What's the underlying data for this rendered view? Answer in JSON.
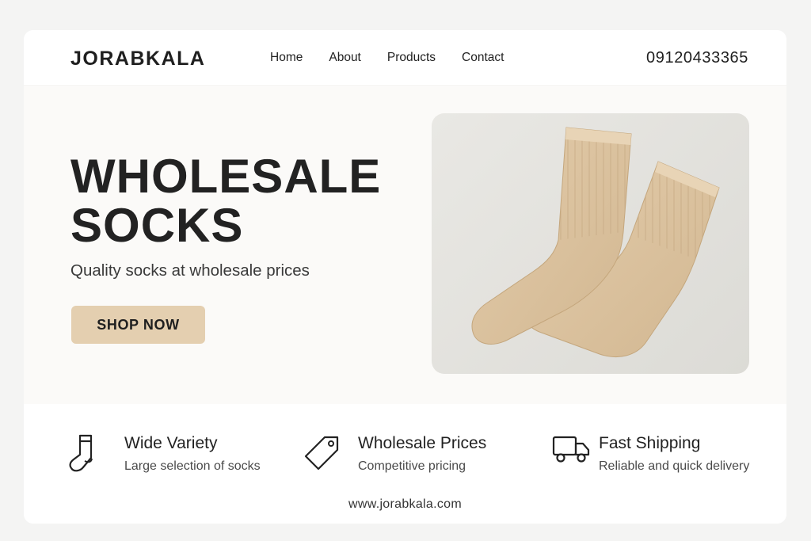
{
  "brand": {
    "logo_text": "JORABKALA"
  },
  "nav": {
    "items": [
      {
        "label": "Home"
      },
      {
        "label": "About"
      },
      {
        "label": "Products"
      },
      {
        "label": "Contact"
      }
    ]
  },
  "header": {
    "phone": "09120433365"
  },
  "hero": {
    "title_line1": "WHOLESALE",
    "title_line2": "SOCKS",
    "subtitle": "Quality socks at wholesale prices",
    "cta_label": "SHOP NOW",
    "image_icon": "beige-socks-photo"
  },
  "features": [
    {
      "icon": "sock-icon",
      "title": "Wide Variety",
      "description": "Large selection of socks"
    },
    {
      "icon": "price-tag-icon",
      "title": "Wholesale Prices",
      "description": "Competitive pricing"
    },
    {
      "icon": "truck-icon",
      "title": "Fast Shipping",
      "description": "Reliable and quick delivery"
    }
  ],
  "footer": {
    "website": "www.jorabkala.com"
  },
  "colors": {
    "accent": "#e4cfb0",
    "sock": "#dcc3a0",
    "hero_bg": "#fbfaf8",
    "text": "#222222"
  }
}
